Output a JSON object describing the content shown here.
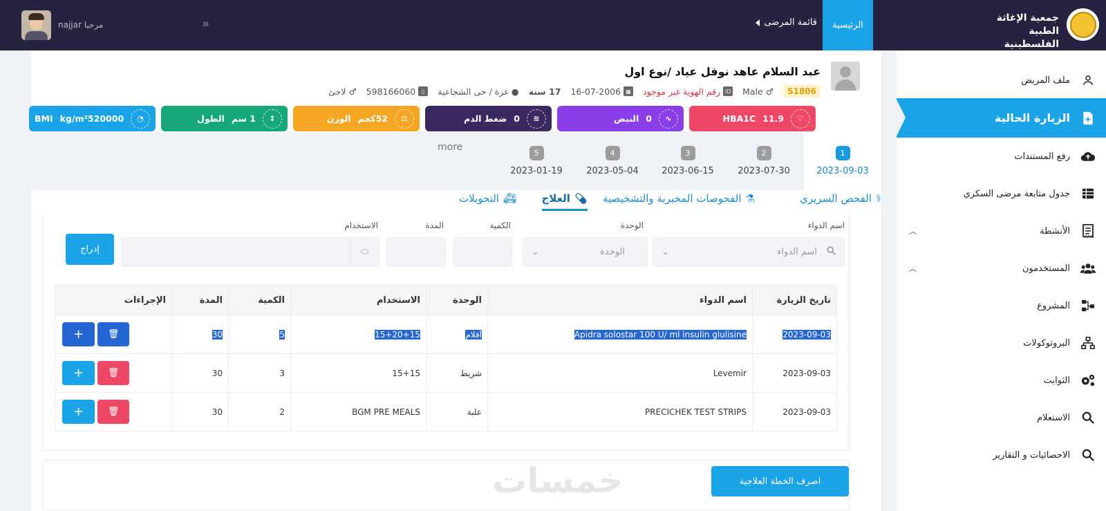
{
  "topbar": {
    "org_line1": "جمعية الإغاثة الطبية",
    "org_line2": "الفلسطينية",
    "nav_home": "الرئيسية",
    "nav_patients": "قائمة المرضى",
    "welcome": "مرحبا najjar"
  },
  "sidebar": {
    "items": [
      {
        "label": "ملف المريض",
        "icon": "user-icon"
      },
      {
        "label": "الزيارة الحالية",
        "icon": "file-plus-icon"
      },
      {
        "label": "رفع المستندات",
        "icon": "cloud-upload-icon"
      },
      {
        "label": "جدول متابعة مرضى السكري",
        "icon": "table-icon"
      },
      {
        "label": "الأنشطة",
        "icon": "receipt-icon"
      },
      {
        "label": "المستخدمون",
        "icon": "users-icon"
      },
      {
        "label": "المشروع",
        "icon": "nodes-icon"
      },
      {
        "label": "البروتوكولات",
        "icon": "sitemap-icon"
      },
      {
        "label": "الثوابت",
        "icon": "gears-icon"
      },
      {
        "label": "الاستعلام",
        "icon": "search-icon"
      },
      {
        "label": "الاحصائيات و التقارير",
        "icon": "search-icon"
      }
    ]
  },
  "patient": {
    "name": "عبد السلام عاهد نوفل عياد /نوع اول",
    "file_no": "S1806",
    "gender": "Male",
    "id_status": "رقم الهوية غير موجود",
    "dob": "16-07-2006",
    "age": "17 سنة",
    "location": "غزة / حى الشجاعية",
    "phone": "598166060",
    "refugee": "لاجئ"
  },
  "vitals": [
    {
      "label": "HBA1C",
      "value": "11.9",
      "color": "#ee4866",
      "icon": "heart-pulse-icon"
    },
    {
      "label": "النبض",
      "value": "0",
      "color": "#8a3ee8",
      "icon": "pulse-icon"
    },
    {
      "label": "ضغط الدم",
      "value": "0",
      "color": "#3a2960",
      "icon": "pressure-icon"
    },
    {
      "label": "الوزن",
      "value": "52كجم",
      "color": "#f5a623",
      "icon": "weight-icon"
    },
    {
      "label": "الطول",
      "value": "1 سم",
      "color": "#16a77a",
      "icon": "height-icon"
    },
    {
      "label": "BMI",
      "value": "kg/m²520000",
      "color": "#1ba3e8",
      "icon": "bmi-icon"
    }
  ],
  "visits": [
    {
      "num": "1",
      "date": "2023-09-03"
    },
    {
      "num": "2",
      "date": "2023-07-30"
    },
    {
      "num": "3",
      "date": "2023-06-15"
    },
    {
      "num": "4",
      "date": "2023-05-04"
    },
    {
      "num": "5",
      "date": "2023-01-19"
    }
  ],
  "visits_more": "more",
  "tabs": [
    "الفحص السريري",
    "الفحوصات المخبرية والتشخيصية",
    "العلاج",
    "التحويلات"
  ],
  "form": {
    "drug_label": "اسم الدواء",
    "drug_placeholder": "اسم الدواء",
    "unit_label": "الوحدة",
    "unit_placeholder": "الوحدة",
    "qty_label": "الكمية",
    "duration_label": "المدة",
    "usage_label": "الاستخدام",
    "insert": "إدراج"
  },
  "table": {
    "headers": [
      "تاريخ الزيارة",
      "اسم الدواء",
      "الوحدة",
      "الاستخدام",
      "الكمية",
      "المدة",
      "الإجراءات"
    ],
    "rows": [
      {
        "date": "2023-09-03",
        "drug": "Apidra solostar 100 U/ ml insulin glulisine",
        "unit": "أقلام",
        "usage": "15+20+15",
        "qty": "5",
        "duration": "30"
      },
      {
        "date": "2023-09-03",
        "drug": "Levemir",
        "unit": "شريط",
        "usage": "15+15",
        "qty": "3",
        "duration": "30"
      },
      {
        "date": "2023-09-03",
        "drug": "PRECICHEK TEST STRIPS",
        "unit": "علبة",
        "usage": "BGM PRE MEALS",
        "qty": "2",
        "duration": "30"
      }
    ]
  },
  "footer": {
    "dispense": "اصرف الخطة العلاجية",
    "watermark": "خمسات"
  }
}
